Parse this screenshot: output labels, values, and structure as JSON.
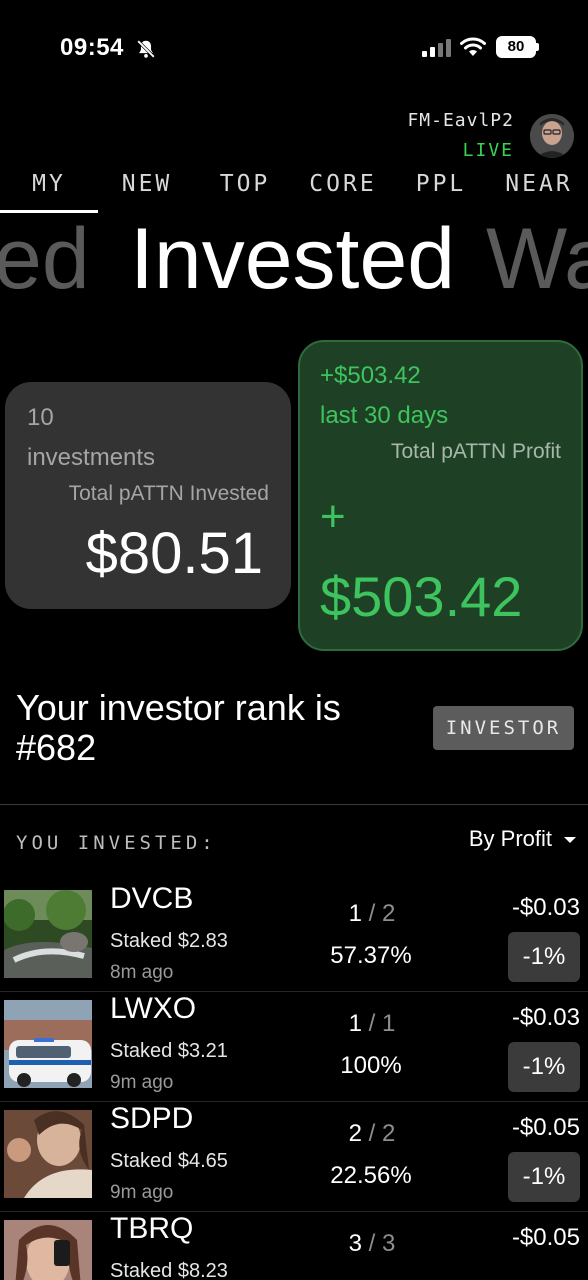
{
  "status_bar": {
    "time": "09:54",
    "battery": "80"
  },
  "user": {
    "id": "FM-EavlP2",
    "live": "LIVE"
  },
  "tabs": [
    "MY",
    "NEW",
    "TOP",
    "CORE",
    "PPL",
    "NEAR"
  ],
  "active_tab": "MY",
  "hero": {
    "prev": "ed",
    "title": "Invested",
    "next": "Wa"
  },
  "invested_card": {
    "count": "10",
    "count_unit": "investments",
    "label": "Total pATTN Invested",
    "amount": "$80.51"
  },
  "profit_card": {
    "amount_small": "+$503.42",
    "period": "last 30 days",
    "label": "Total pATTN Profit",
    "plus": "+",
    "amount_big": "$503.42"
  },
  "rank": {
    "text": "Your investor rank is #682",
    "badge": "INVESTOR"
  },
  "list": {
    "title": "YOU INVESTED:",
    "sort": "By Profit",
    "items": [
      {
        "symbol": "DVCB",
        "staked": "Staked $2.83",
        "ago": "8m ago",
        "num": "1",
        "den": "2",
        "percent": "57.37%",
        "pnl": "-$0.03",
        "change": "-1%"
      },
      {
        "symbol": "LWXO",
        "staked": "Staked $3.21",
        "ago": "9m ago",
        "num": "1",
        "den": "1",
        "percent": "100%",
        "pnl": "-$0.03",
        "change": "-1%"
      },
      {
        "symbol": "SDPD",
        "staked": "Staked $4.65",
        "ago": "9m ago",
        "num": "2",
        "den": "2",
        "percent": "22.56%",
        "pnl": "-$0.05",
        "change": "-1%"
      },
      {
        "symbol": "TBRQ",
        "staked": "Staked $8.23",
        "ago": "",
        "num": "3",
        "den": "3",
        "percent": "",
        "pnl": "-$0.05",
        "change": ""
      }
    ]
  },
  "colors": {
    "accent_green": "#3ec45e",
    "profit_card_bg": "#1e4126",
    "card_bg": "#333333"
  }
}
